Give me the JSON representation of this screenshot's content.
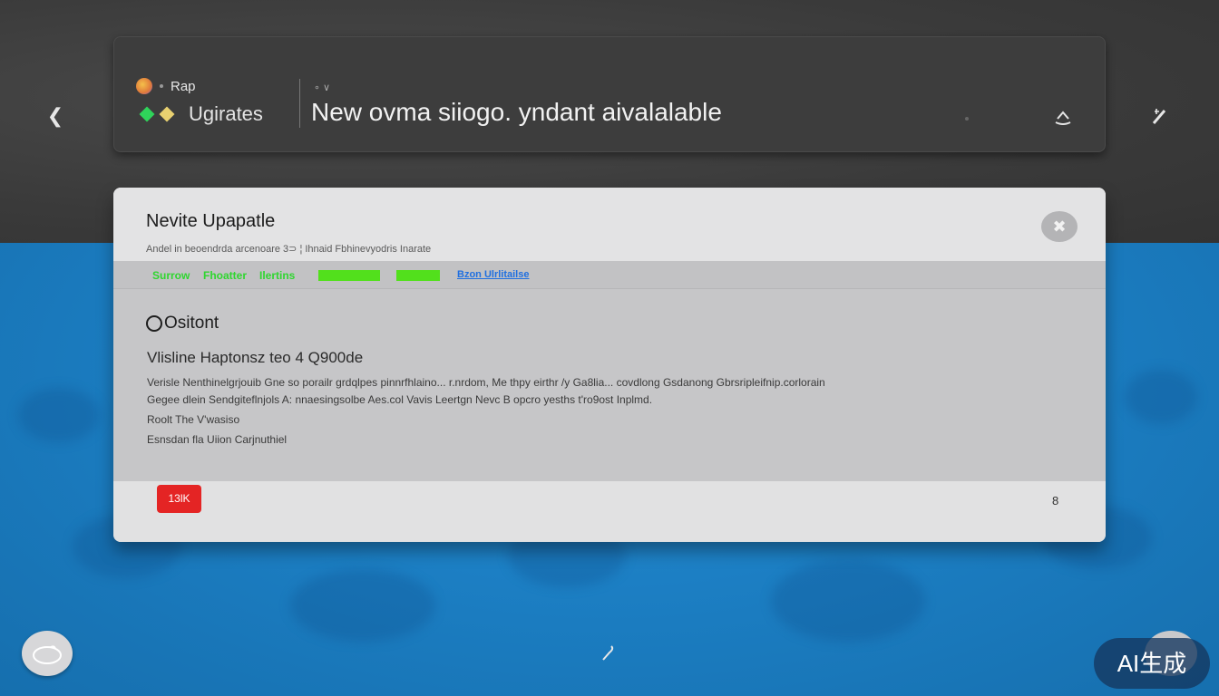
{
  "notification": {
    "app_name": "Rap",
    "category": "Ugirates",
    "caption": "∘ ∨",
    "headline": "New ovma siiogo. yndant aivalalable",
    "back_icon": "chevron-left-icon",
    "share_icon": "eject-icon",
    "pen_icon": "pen-icon"
  },
  "dialog": {
    "title": "Nevite Upapatle",
    "subtitle": "Andel in beoendrda arcenoare 3⊃ ¦ Ihnaid Fbhinevyodris Inarate",
    "close_icon": "close-icon",
    "status": {
      "label1": "Surrow",
      "label2": "Fhoatter",
      "label3": "Ilertins",
      "link": "Bzon Ulrlitailse",
      "bar_color": "#52e01c"
    },
    "option_label": "Ositont",
    "section_title": "Vlisline Haptonsz teo 4 Q900de",
    "body_lines": [
      "Verisle Nenthinelgrjouib Gne so porailr grdqlpes pinnrfhlaino... r.nrdom, Me thpy eirthr /y Ga8lia... covdlong Gsdanong Gbrsripleifnip.corlorain",
      "Gegee dlein Sendgiteflnjols A: nnaesingsolbe Aes.col Vavis Leertgn Nevc B opcro yesths t'ro9ost Inplmd.",
      "Roolt The V'wasiso",
      "Esnsdan fla Uiion Carjnuthiel"
    ],
    "footer": {
      "button_label": "13lK",
      "count": "8"
    }
  },
  "bottom": {
    "left_button_icon": "cloud-icon",
    "center_icon": "hook-icon",
    "badge": "AI生成"
  }
}
